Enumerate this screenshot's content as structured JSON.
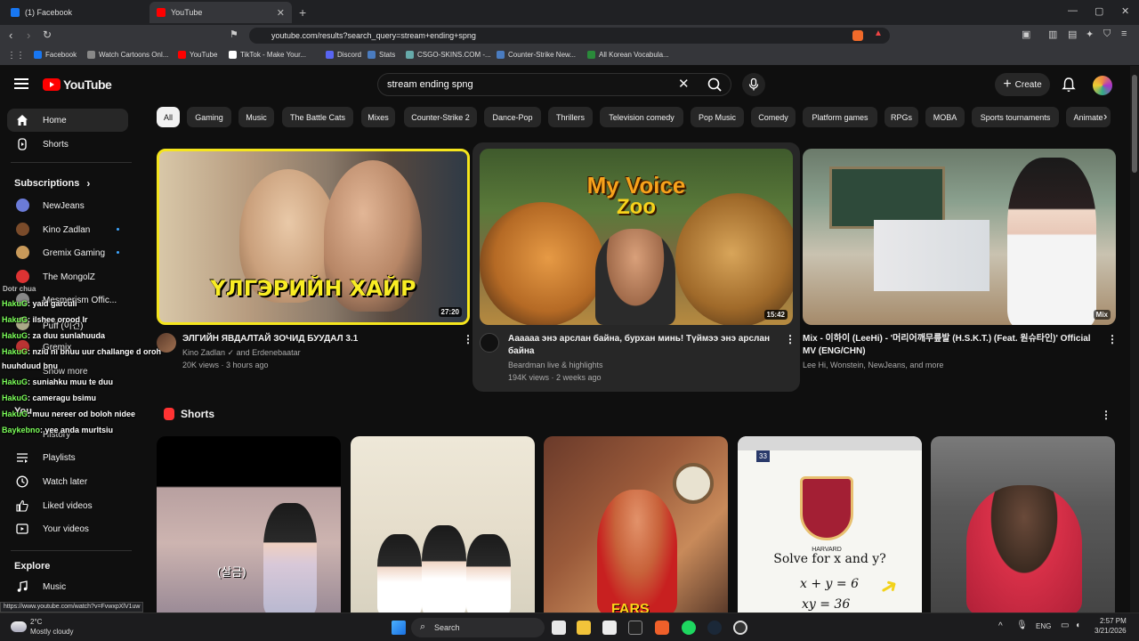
{
  "browser": {
    "tabs": [
      {
        "title": "(1) Facebook",
        "color": "#1877f2"
      },
      {
        "title": "YouTube",
        "color": "#ff0000"
      }
    ],
    "url": "youtube.com/results?search_query=stream+ending+spng",
    "bookmarks": [
      {
        "label": "Facebook",
        "color": "#1877f2"
      },
      {
        "label": "Watch Cartoons Onl...",
        "color": "#888888"
      },
      {
        "label": "YouTube",
        "color": "#ff0000"
      },
      {
        "label": "TikTok - Make Your...",
        "color": "#ffffff"
      },
      {
        "label": "Discord",
        "color": "#5865f2"
      },
      {
        "label": "Stats",
        "color": "#4a7cc0"
      },
      {
        "label": "CSGO-SKINS.COM -...",
        "color": "#6aa"
      },
      {
        "label": "Counter-Strike New...",
        "color": "#4a7cc0"
      },
      {
        "label": "All Korean Vocabula...",
        "color": "#2a8a3a"
      }
    ],
    "status_url": "https://www.youtube.com/watch?v=FvwxpXlV1uw"
  },
  "header": {
    "logo": "YouTube",
    "search_value": "stream ending spng",
    "create_label": "Create"
  },
  "sidebar": {
    "home": "Home",
    "shorts": "Shorts",
    "subscriptions_title": "Subscriptions",
    "subs": [
      {
        "name": "NewJeans",
        "color": "#6b7bd8",
        "dot": false
      },
      {
        "name": "Kino Zadlan",
        "color": "#7a4b2a",
        "dot": true
      },
      {
        "name": "Gremix Gaming",
        "color": "#c99a5a",
        "dot": true
      },
      {
        "name": "The MongolZ",
        "color": "#d33",
        "dot": false
      },
      {
        "name": "Mesmerism Offic...",
        "color": "#888",
        "dot": false
      },
      {
        "name": "Puff (이건)",
        "color": "#aa8",
        "dot": false
      },
      {
        "name": "Gremix",
        "color": "#b33",
        "dot": false
      }
    ],
    "show_more": "Show more",
    "you_title": "You",
    "you_items": [
      "History",
      "Playlists",
      "Watch later",
      "Liked videos",
      "Your videos"
    ],
    "explore_title": "Explore",
    "explore_items": [
      "Music"
    ]
  },
  "chat": {
    "header": "Dotr chua",
    "messages": [
      {
        "name": "HakuG",
        "text": ": yaid garculi"
      },
      {
        "name": "HakuG",
        "text": ": ilshee orood Ir"
      },
      {
        "name": "HakuG",
        "text": ": za duu sunlahuuda"
      },
      {
        "name": "HakuG",
        "text": ": nziu ni bnuu uur challange d oroh"
      },
      {
        "name": "",
        "text": "huuhduud bnu"
      },
      {
        "name": "HakuG",
        "text": ": suniahku muu te duu"
      },
      {
        "name": "HakuG",
        "text": ": cameragu bsimu"
      },
      {
        "name": "HakuG",
        "text": ": muu nereer od boloh nidee"
      },
      {
        "name": "Baykebno",
        "text": ": yee anda murltsiu"
      }
    ]
  },
  "chips": [
    "All",
    "Gaming",
    "Music",
    "The Battle Cats",
    "Mixes",
    "Counter-Strike 2",
    "Dance-Pop",
    "Thrillers",
    "Television comedy",
    "Pop Music",
    "Comedy",
    "Platform games",
    "RPGs",
    "MOBA",
    "Sports tournaments",
    "Animate"
  ],
  "videos": [
    {
      "thumb_text": "ҮЛГЭРИЙН ХАЙР",
      "duration": "27:20",
      "title": "ЭЛГИЙН ЯВДАЛТАЙ ЗОЧИД БУУДАЛ 3.1",
      "channel": "Kino Zadlan ✓ and Erdenebaatar",
      "meta": "20K views · 3 hours ago"
    },
    {
      "thumb_text_1": "My Voice",
      "thumb_text_2": "Zoo",
      "duration": "15:42",
      "title": "Аааааа энэ арслан байна, бурхан минь! Түймээ энэ арслан байна",
      "channel": "Beardman live & highlights",
      "meta": "194K views · 2 weeks ago"
    },
    {
      "duration": "Mix",
      "title": "Mix - 이하이 (LeeHi) - '머리어깨무릎발 (H.S.K.T.) (Feat. 원슈타인)' Official MV (ENG/CHN)",
      "channel": "Lee Hi, Wonstein, NewJeans, and more",
      "meta": ""
    }
  ],
  "shorts": {
    "title": "Shorts",
    "items": [
      {
        "caption": "(살금)"
      },
      {
        "caption": ""
      },
      {
        "caption": "FARS"
      },
      {
        "caption": "Solve for x and y?",
        "eq1": "x + y = 6",
        "eq2": "xy = 36",
        "badge": "33",
        "seal": "HARVARD"
      },
      {
        "caption": ""
      }
    ]
  },
  "taskbar": {
    "weather_temp": "2°C",
    "weather_desc": "Mostly cloudy",
    "search": "Search",
    "lang": "ENG",
    "time": "2:57 PM",
    "date": "3/21/2026"
  }
}
